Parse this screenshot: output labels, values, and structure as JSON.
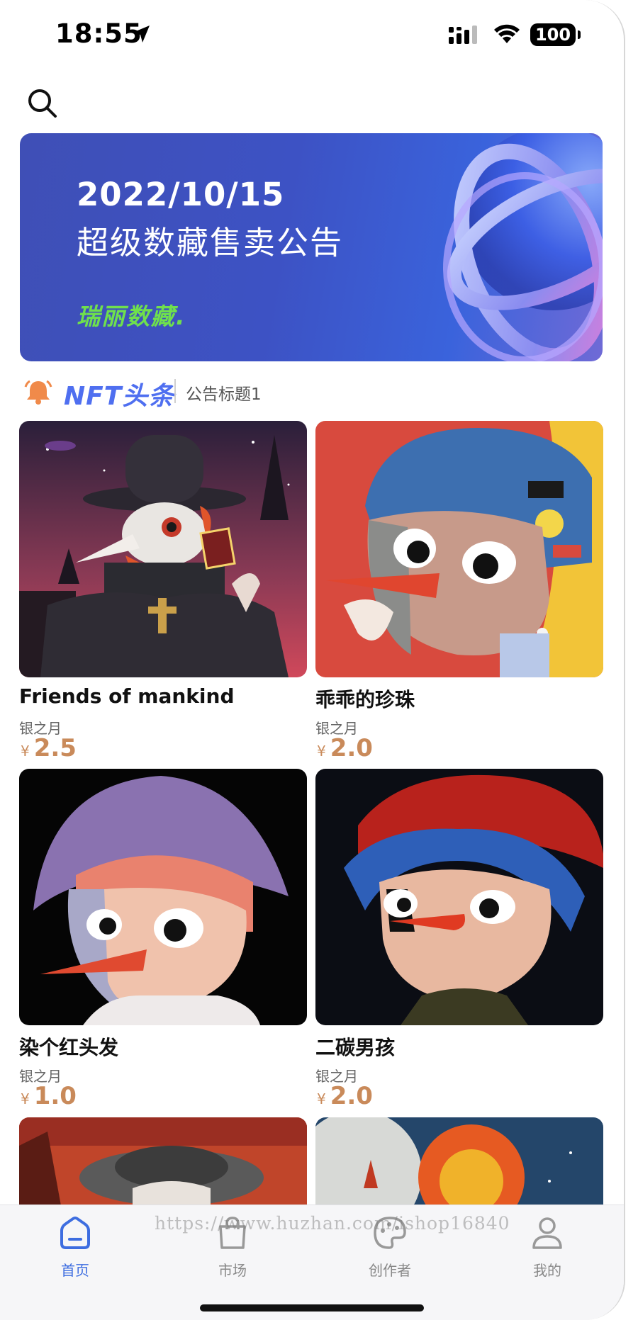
{
  "status_bar": {
    "time": "18:55",
    "battery": "100"
  },
  "search": {
    "icon": "search-icon"
  },
  "banner": {
    "date": "2022/10/15",
    "title": "超级数藏售卖公告",
    "brand": "瑞丽数藏."
  },
  "headline": {
    "logo": "NFT头条",
    "text": "公告标题1"
  },
  "items": [
    {
      "name": "Friends of mankind",
      "creator": "银之月",
      "currency": "¥",
      "price": "2.5"
    },
    {
      "name": "乖乖的珍珠",
      "creator": "银之月",
      "currency": "¥",
      "price": "2.0"
    },
    {
      "name": "染个红头发",
      "creator": "银之月",
      "currency": "¥",
      "price": "1.0"
    },
    {
      "name": "二碳男孩",
      "creator": "银之月",
      "currency": "¥",
      "price": "2.0"
    }
  ],
  "tabs": [
    {
      "label": "首页",
      "icon": "home-icon",
      "active": true
    },
    {
      "label": "市场",
      "icon": "shopping-bag-icon",
      "active": false
    },
    {
      "label": "创作者",
      "icon": "palette-icon",
      "active": false
    },
    {
      "label": "我的",
      "icon": "user-icon",
      "active": false
    }
  ],
  "watermark": "https://www.huzhan.com/ishop16840",
  "colors": {
    "accent": "#3d6de0",
    "price": "#c98a5a",
    "brand_green": "#6fe04d"
  }
}
